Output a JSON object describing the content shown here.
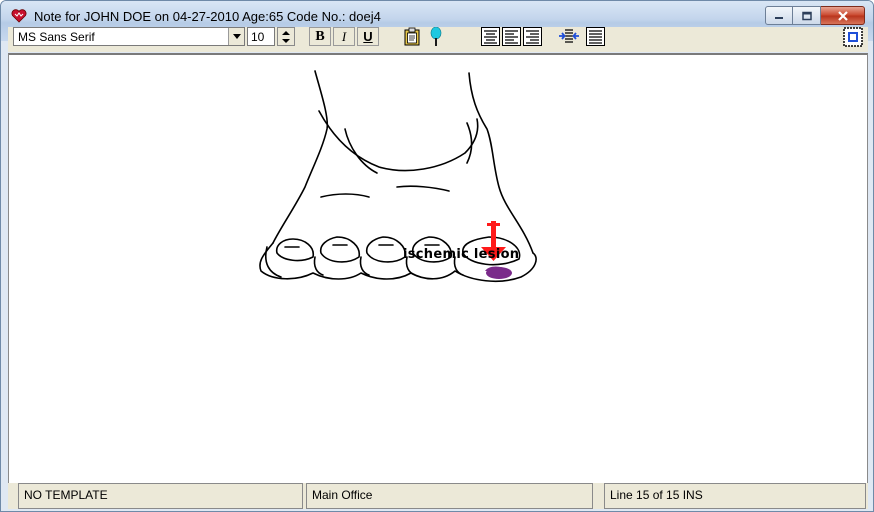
{
  "window": {
    "title": "Note for JOHN DOE on 04-27-2010 Age:65  Code No.: doej4",
    "icon": "heart-icon"
  },
  "toolbar": {
    "font_name": "MS Sans Serif",
    "font_size": "10",
    "bold_label": "B",
    "italic_label": "I",
    "underline_label": "U"
  },
  "editor": {
    "annotation": "ischemic lesion",
    "drawing": "foot-illustration"
  },
  "status": {
    "template": "NO TEMPLATE",
    "office": "Main Office",
    "position": "Line 15 of 15  INS"
  },
  "colors": {
    "arrow": "#ff1a1a",
    "lesion": "#7a2a8a",
    "close_button": "#c9462c"
  }
}
